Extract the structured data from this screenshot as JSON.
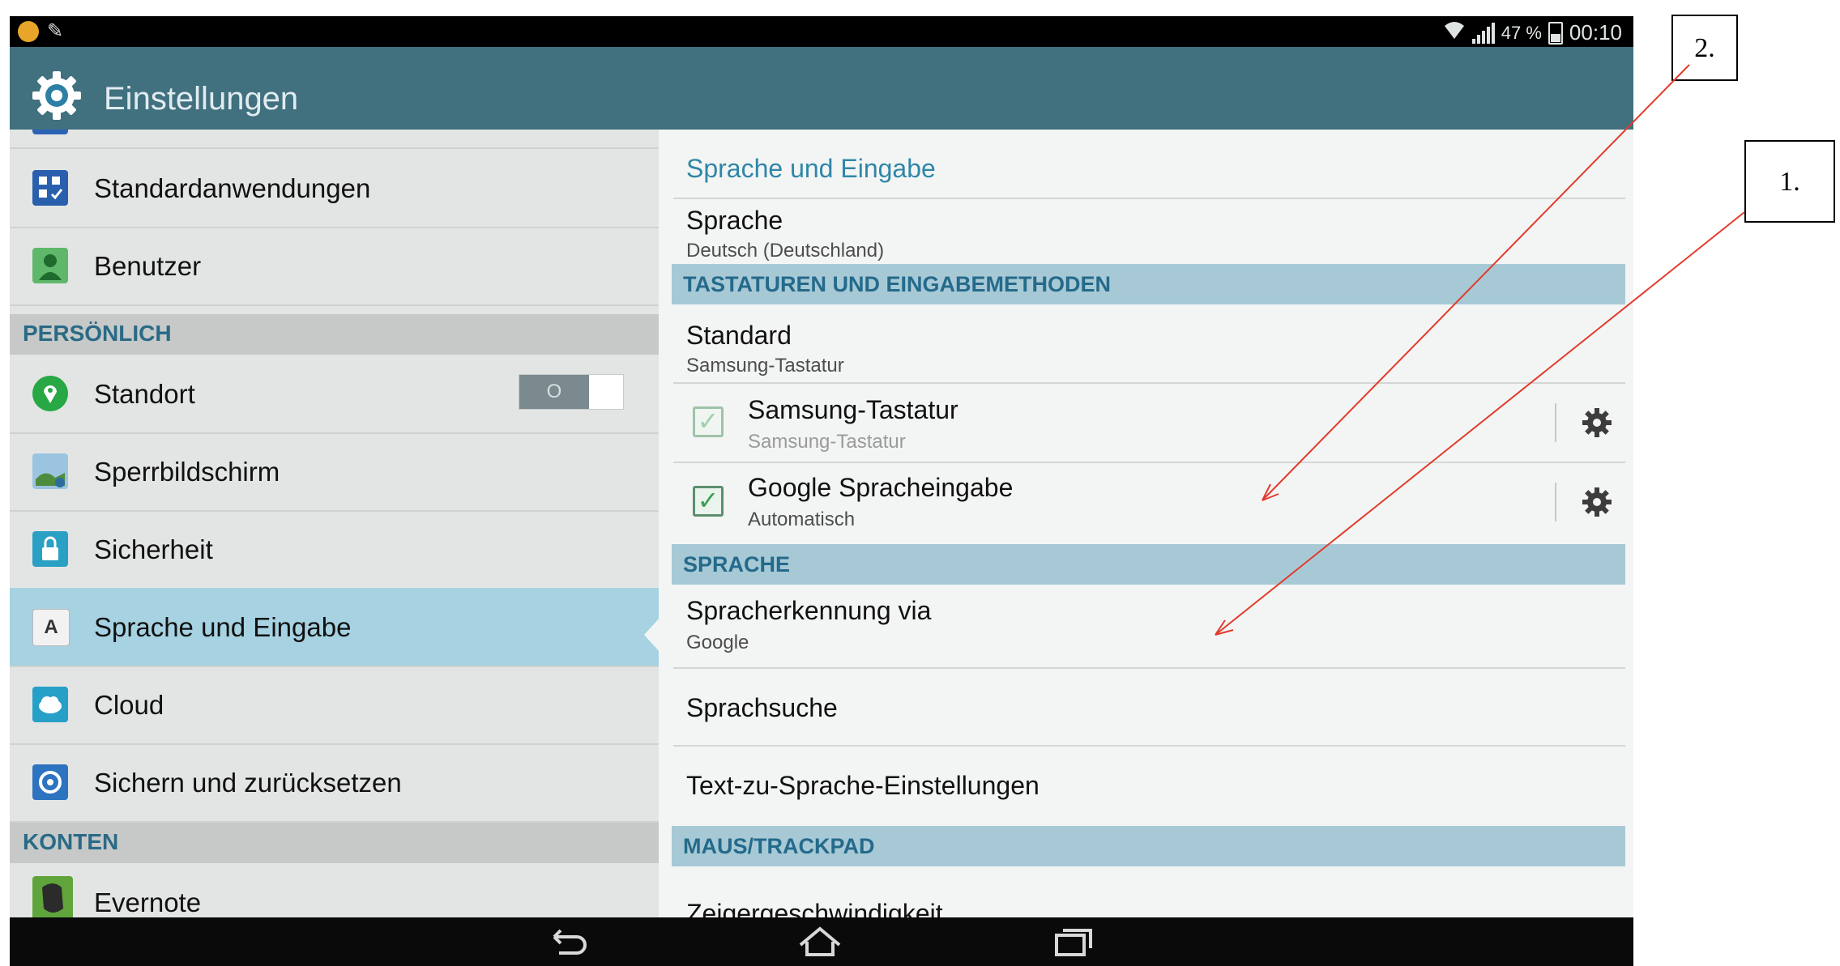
{
  "statusbar": {
    "battery": "47 %",
    "time": "00:10"
  },
  "app": {
    "title": "Einstellungen"
  },
  "left": {
    "items_top": [
      {
        "label": "Standardanwendungen",
        "icon": "apps-grid-icon"
      },
      {
        "label": "Benutzer",
        "icon": "user-icon"
      }
    ],
    "section_personal": "PERSÖNLICH",
    "items_personal": [
      {
        "label": "Standort",
        "icon": "location-icon"
      },
      {
        "label": "Sperrbildschirm",
        "icon": "lockscreen-icon"
      },
      {
        "label": "Sicherheit",
        "icon": "lock-icon"
      },
      {
        "label": "Sprache und Eingabe",
        "icon": "language-a-icon",
        "selected": true
      },
      {
        "label": "Cloud",
        "icon": "cloud-icon"
      },
      {
        "label": "Sichern und zurücksetzen",
        "icon": "backup-icon"
      }
    ],
    "toggle_state": "O",
    "section_accounts": "KONTEN",
    "items_accounts": [
      {
        "label": "Evernote",
        "icon": "evernote-icon"
      }
    ]
  },
  "right": {
    "title": "Sprache und Eingabe",
    "language": {
      "title": "Sprache",
      "value": "Deutsch (Deutschland)"
    },
    "section_keyboards": "TASTATUREN UND EINGABEMETHODEN",
    "default": {
      "title": "Standard",
      "value": "Samsung-Tastatur"
    },
    "samsung": {
      "title": "Samsung-Tastatur",
      "value": "Samsung-Tastatur",
      "checked": true
    },
    "google_voice": {
      "title": "Google Spracheingabe",
      "value": "Automatisch",
      "checked": true
    },
    "section_speech": "SPRACHE",
    "recognition": {
      "title": "Spracherkennung via",
      "value": "Google"
    },
    "voice_search": "Sprachsuche",
    "tts": "Text-zu-Sprache-Einstellungen",
    "section_mouse": "MAUS/TRACKPAD",
    "pointer_speed": "Zeigergeschwindigkeit"
  },
  "callouts": {
    "one": "1.",
    "two": "2."
  },
  "colors": {
    "actionbar": "#41707f",
    "selected": "#a6d2e2",
    "section_header": "#a7c9d6",
    "accent_text": "#2f86a8",
    "annotation_arrow": "#e23b2c"
  }
}
